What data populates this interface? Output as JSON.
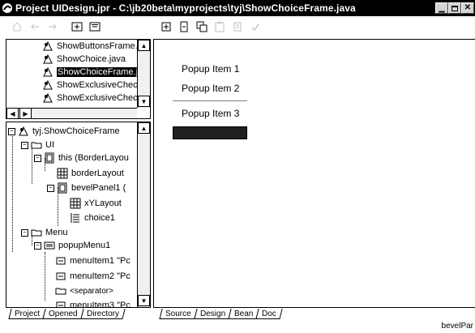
{
  "window": {
    "title": "Project UIDesign.jpr - C:\\jb20beta\\myprojects\\tyj\\ShowChoiceFrame.java",
    "minimize_glyph": "▁",
    "close_glyph": "✕"
  },
  "toolbar": {
    "left_icons": [
      "home-icon",
      "back-arrow-icon",
      "forward-arrow-icon",
      "add-file-icon",
      "remove-file-icon"
    ],
    "right_icons": [
      "add-item-icon",
      "insert-icon",
      "copy-icon",
      "paste-icon",
      "delete-icon",
      "check-icon"
    ]
  },
  "files": [
    {
      "label": "ShowButtonsFrame.jav",
      "selected": false
    },
    {
      "label": "ShowChoice.java",
      "selected": false
    },
    {
      "label": "ShowChoiceFrame.jav",
      "selected": true
    },
    {
      "label": "ShowExclusiveCheckl",
      "selected": false
    },
    {
      "label": "ShowExclusiveCheckl",
      "selected": false
    }
  ],
  "tree": {
    "root": "tyj.ShowChoiceFrame",
    "ui_folder": "UI",
    "this_node": "this (BorderLayou",
    "border_layout": "borderLayout",
    "bevel_panel": "bevelPanel1 (",
    "xy_layout": "xYLayout",
    "choice": "choice1",
    "menu_folder": "Menu",
    "popup_menu": "popupMenu1",
    "menu_item1": "menuItem1 \"Pc",
    "menu_item2": "menuItem2 \"Pc",
    "separator": "<separator>",
    "menu_item3": "menuItem3 \"Pc"
  },
  "popup": {
    "items": [
      "Popup Item 1",
      "Popup Item 2",
      "Popup Item 3"
    ]
  },
  "left_tabs": [
    "Project",
    "Opened",
    "Directory"
  ],
  "editor_tabs": [
    "Source",
    "Design",
    "Bean",
    "Doc"
  ],
  "active_editor_tab": "Design",
  "active_left_tab": "Project",
  "status": {
    "right_text": "bevelPar"
  }
}
